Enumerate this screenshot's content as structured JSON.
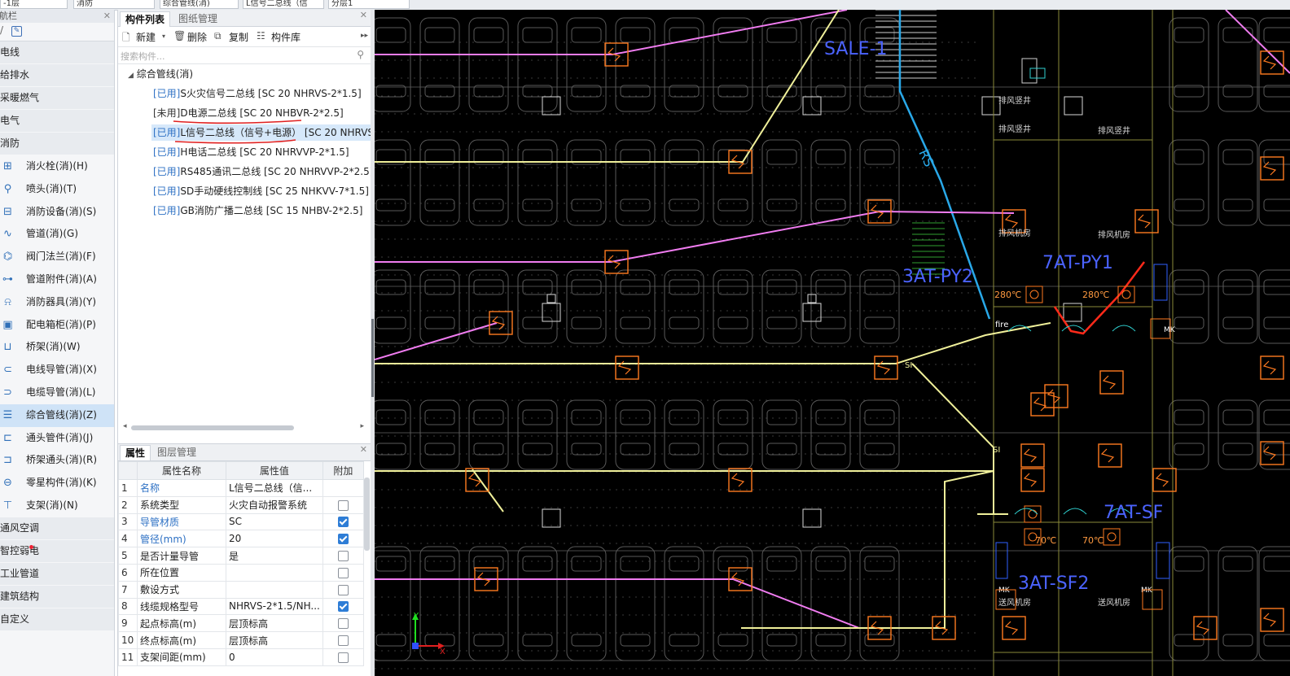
{
  "toolbar_dropdowns": [
    "-1层",
    "消防",
    "综合管线(消)",
    "L信号二总线（信",
    "分层1"
  ],
  "nav": {
    "title": "导航栏",
    "categories_top": [
      "电线",
      "给排水",
      "采暖燃气",
      "电气",
      "消防"
    ],
    "items": [
      {
        "label": "消火栓(消)(H)",
        "icon": "hydrant-icon"
      },
      {
        "label": "喷头(消)(T)",
        "icon": "sprinkler-icon"
      },
      {
        "label": "消防设备(消)(S)",
        "icon": "equipment-icon"
      },
      {
        "label": "管道(消)(G)",
        "icon": "pipe-icon"
      },
      {
        "label": "阀门法兰(消)(F)",
        "icon": "valve-icon"
      },
      {
        "label": "管道附件(消)(A)",
        "icon": "pipe-accessory-icon"
      },
      {
        "label": "消防器具(消)(Y)",
        "icon": "alarm-device-icon"
      },
      {
        "label": "配电箱柜(消)(P)",
        "icon": "panel-box-icon"
      },
      {
        "label": "桥架(消)(W)",
        "icon": "cable-tray-icon"
      },
      {
        "label": "电线导管(消)(X)",
        "icon": "wire-conduit-icon"
      },
      {
        "label": "电缆导管(消)(L)",
        "icon": "cable-conduit-icon"
      },
      {
        "label": "综合管线(消)(Z)",
        "icon": "combined-line-icon"
      },
      {
        "label": "通头管件(消)(J)",
        "icon": "fitting-icon"
      },
      {
        "label": "桥架通头(消)(R)",
        "icon": "tray-fitting-icon"
      },
      {
        "label": "零星构件(消)(K)",
        "icon": "misc-part-icon"
      },
      {
        "label": "支架(消)(N)",
        "icon": "support-icon"
      }
    ],
    "categories_bottom": [
      "通风空调",
      "智控弱电",
      "工业管道",
      "建筑结构",
      "自定义"
    ]
  },
  "panel": {
    "tab_active": "构件列表",
    "tab_other": "图纸管理",
    "actions": {
      "new": "新建",
      "delete": "删除",
      "copy": "复制",
      "library": "构件库"
    },
    "search_placeholder": "搜索构件...",
    "tree_root": "综合管线(消)",
    "tree_items": [
      {
        "status": "[已用]",
        "label": "S火灾信号二总线 [SC 20 NHRVS-2*1.5]"
      },
      {
        "status": "[未用]",
        "label": "D电源二总线 [SC 20 NHBVR-2*2.5]"
      },
      {
        "status": "[已用]",
        "label": "L信号二总线（信号+电源） [SC 20 NHRVS"
      },
      {
        "status": "[已用]",
        "label": "H电话二总线 [SC 20 NHRVVP-2*1.5]"
      },
      {
        "status": "[已用]",
        "label": "RS485通讯二总线 [SC 20 NHRVVP-2*2.5]"
      },
      {
        "status": "[已用]",
        "label": "SD手动硬线控制线 [SC 25 NHKVV-7*1.5]"
      },
      {
        "status": "[已用]",
        "label": "GB消防广播二总线 [SC 15 NHBV-2*2.5]"
      }
    ]
  },
  "properties": {
    "tab_active": "属性",
    "tab_other": "图层管理",
    "headers": [
      "属性名称",
      "属性值",
      "附加"
    ],
    "rows": [
      {
        "no": "1",
        "name": "名称",
        "value": "L信号二总线（信...",
        "checked": null,
        "blue": true
      },
      {
        "no": "2",
        "name": "系统类型",
        "value": "火灾自动报警系统",
        "checked": false,
        "blue": false
      },
      {
        "no": "3",
        "name": "导管材质",
        "value": "SC",
        "checked": true,
        "blue": true
      },
      {
        "no": "4",
        "name": "管径(mm)",
        "value": "20",
        "checked": true,
        "blue": true
      },
      {
        "no": "5",
        "name": "是否计量导管",
        "value": "是",
        "checked": false,
        "blue": false
      },
      {
        "no": "6",
        "name": "所在位置",
        "value": "",
        "checked": false,
        "blue": false
      },
      {
        "no": "7",
        "name": "敷设方式",
        "value": "",
        "checked": false,
        "blue": false
      },
      {
        "no": "8",
        "name": "线缆规格型号",
        "value": "NHRVS-2*1.5/NH...",
        "checked": true,
        "blue": false
      },
      {
        "no": "9",
        "name": "起点标高(m)",
        "value": "层顶标高",
        "checked": false,
        "blue": false
      },
      {
        "no": "10",
        "name": "终点标高(m)",
        "value": "层顶标高",
        "checked": false,
        "blue": false
      },
      {
        "no": "11",
        "name": "支架间距(mm)",
        "value": "0",
        "checked": false,
        "blue": false
      }
    ]
  },
  "drawing": {
    "labels": [
      "SALE-1",
      "RS",
      "3AT-PY2",
      "7AT-PY1",
      "280℃",
      "280℃",
      "fire",
      "MK",
      "MK",
      "MK",
      "7AT-SF",
      "3AT-SF2",
      "70℃",
      "70℃",
      "SI",
      "SI",
      "排风竖井",
      "排风竖井",
      "排风竖井",
      "排风机房",
      "排风机房",
      "送风机房",
      "送风机房"
    ],
    "colors": {
      "background": "#000000",
      "signal_line": "#f0f09a",
      "power_line": "#f07cf0",
      "rs_line": "#29a8e8",
      "red_marker": "#ff2a1a",
      "device": "#ff7a20",
      "cyan": "#2fd0d0"
    }
  }
}
